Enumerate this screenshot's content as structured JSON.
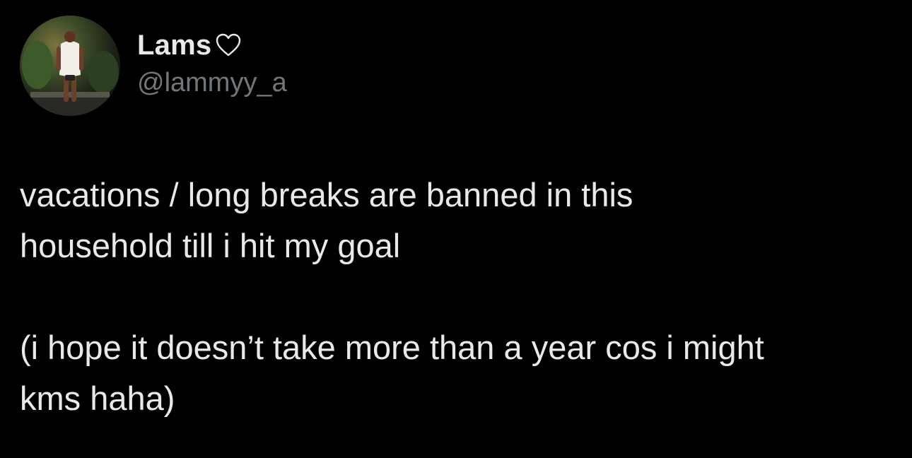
{
  "tweet": {
    "author": {
      "display_name": "Lams",
      "name_suffix_icon": "heart-outline-icon",
      "handle": "@lammyy_a",
      "avatar_icon": "profile-photo"
    },
    "paragraphs": [
      "vacations / long breaks are banned in this\nhousehold till i hit my goal",
      "(i hope it doesn’t take more than a year cos i might\nkms haha)"
    ]
  },
  "colors": {
    "background": "#000000",
    "primary_text": "#e7e9ea",
    "secondary_text": "#71767b"
  }
}
